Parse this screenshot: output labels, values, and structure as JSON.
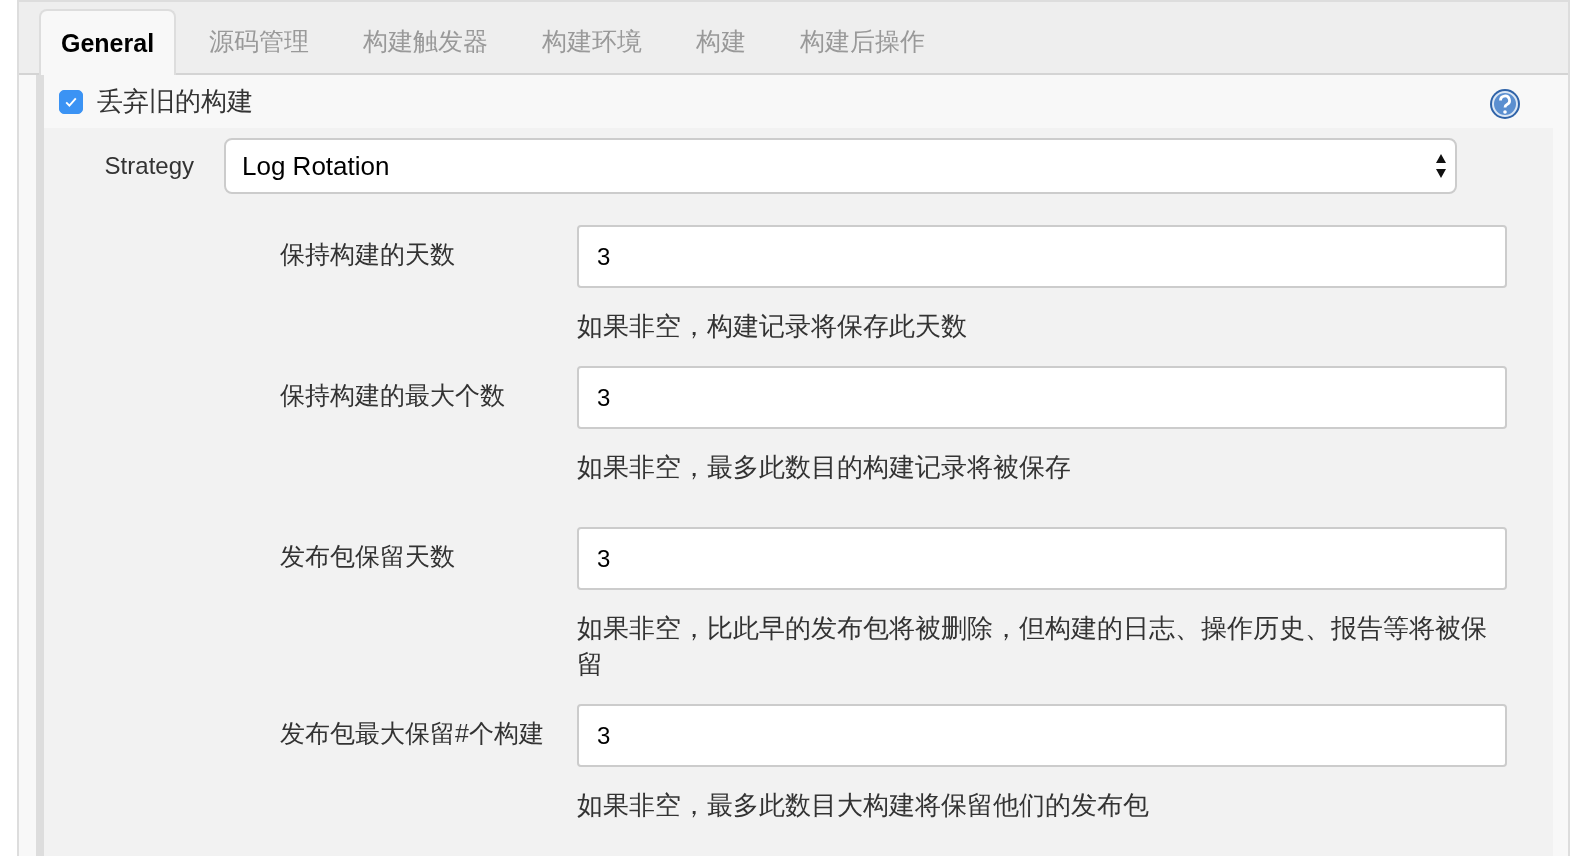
{
  "tabs": [
    {
      "label": "General",
      "selected": true
    },
    {
      "label": "源码管理",
      "selected": false
    },
    {
      "label": "构建触发器",
      "selected": false
    },
    {
      "label": "构建环境",
      "selected": false
    },
    {
      "label": "构建",
      "selected": false
    },
    {
      "label": "构建后操作",
      "selected": false
    }
  ],
  "discard_old_builds": {
    "label": "丢弃旧的构建",
    "checked": true
  },
  "strategy": {
    "label": "Strategy",
    "value": "Log Rotation"
  },
  "fields": [
    {
      "label": "保持构建的天数",
      "value": "3",
      "help": "如果非空，构建记录将保存此天数"
    },
    {
      "label": "保持构建的最大个数",
      "value": "3",
      "help": "如果非空，最多此数目的构建记录将被保存"
    },
    {
      "label": "发布包保留天数",
      "value": "3",
      "help": "如果非空，比此早的发布包将被删除，但构建的日志、操作历史、报告等将被保留"
    },
    {
      "label": "发布包最大保留#个构建",
      "value": "3",
      "help": "如果非空，最多此数目大构建将保留他们的发布包"
    }
  ]
}
